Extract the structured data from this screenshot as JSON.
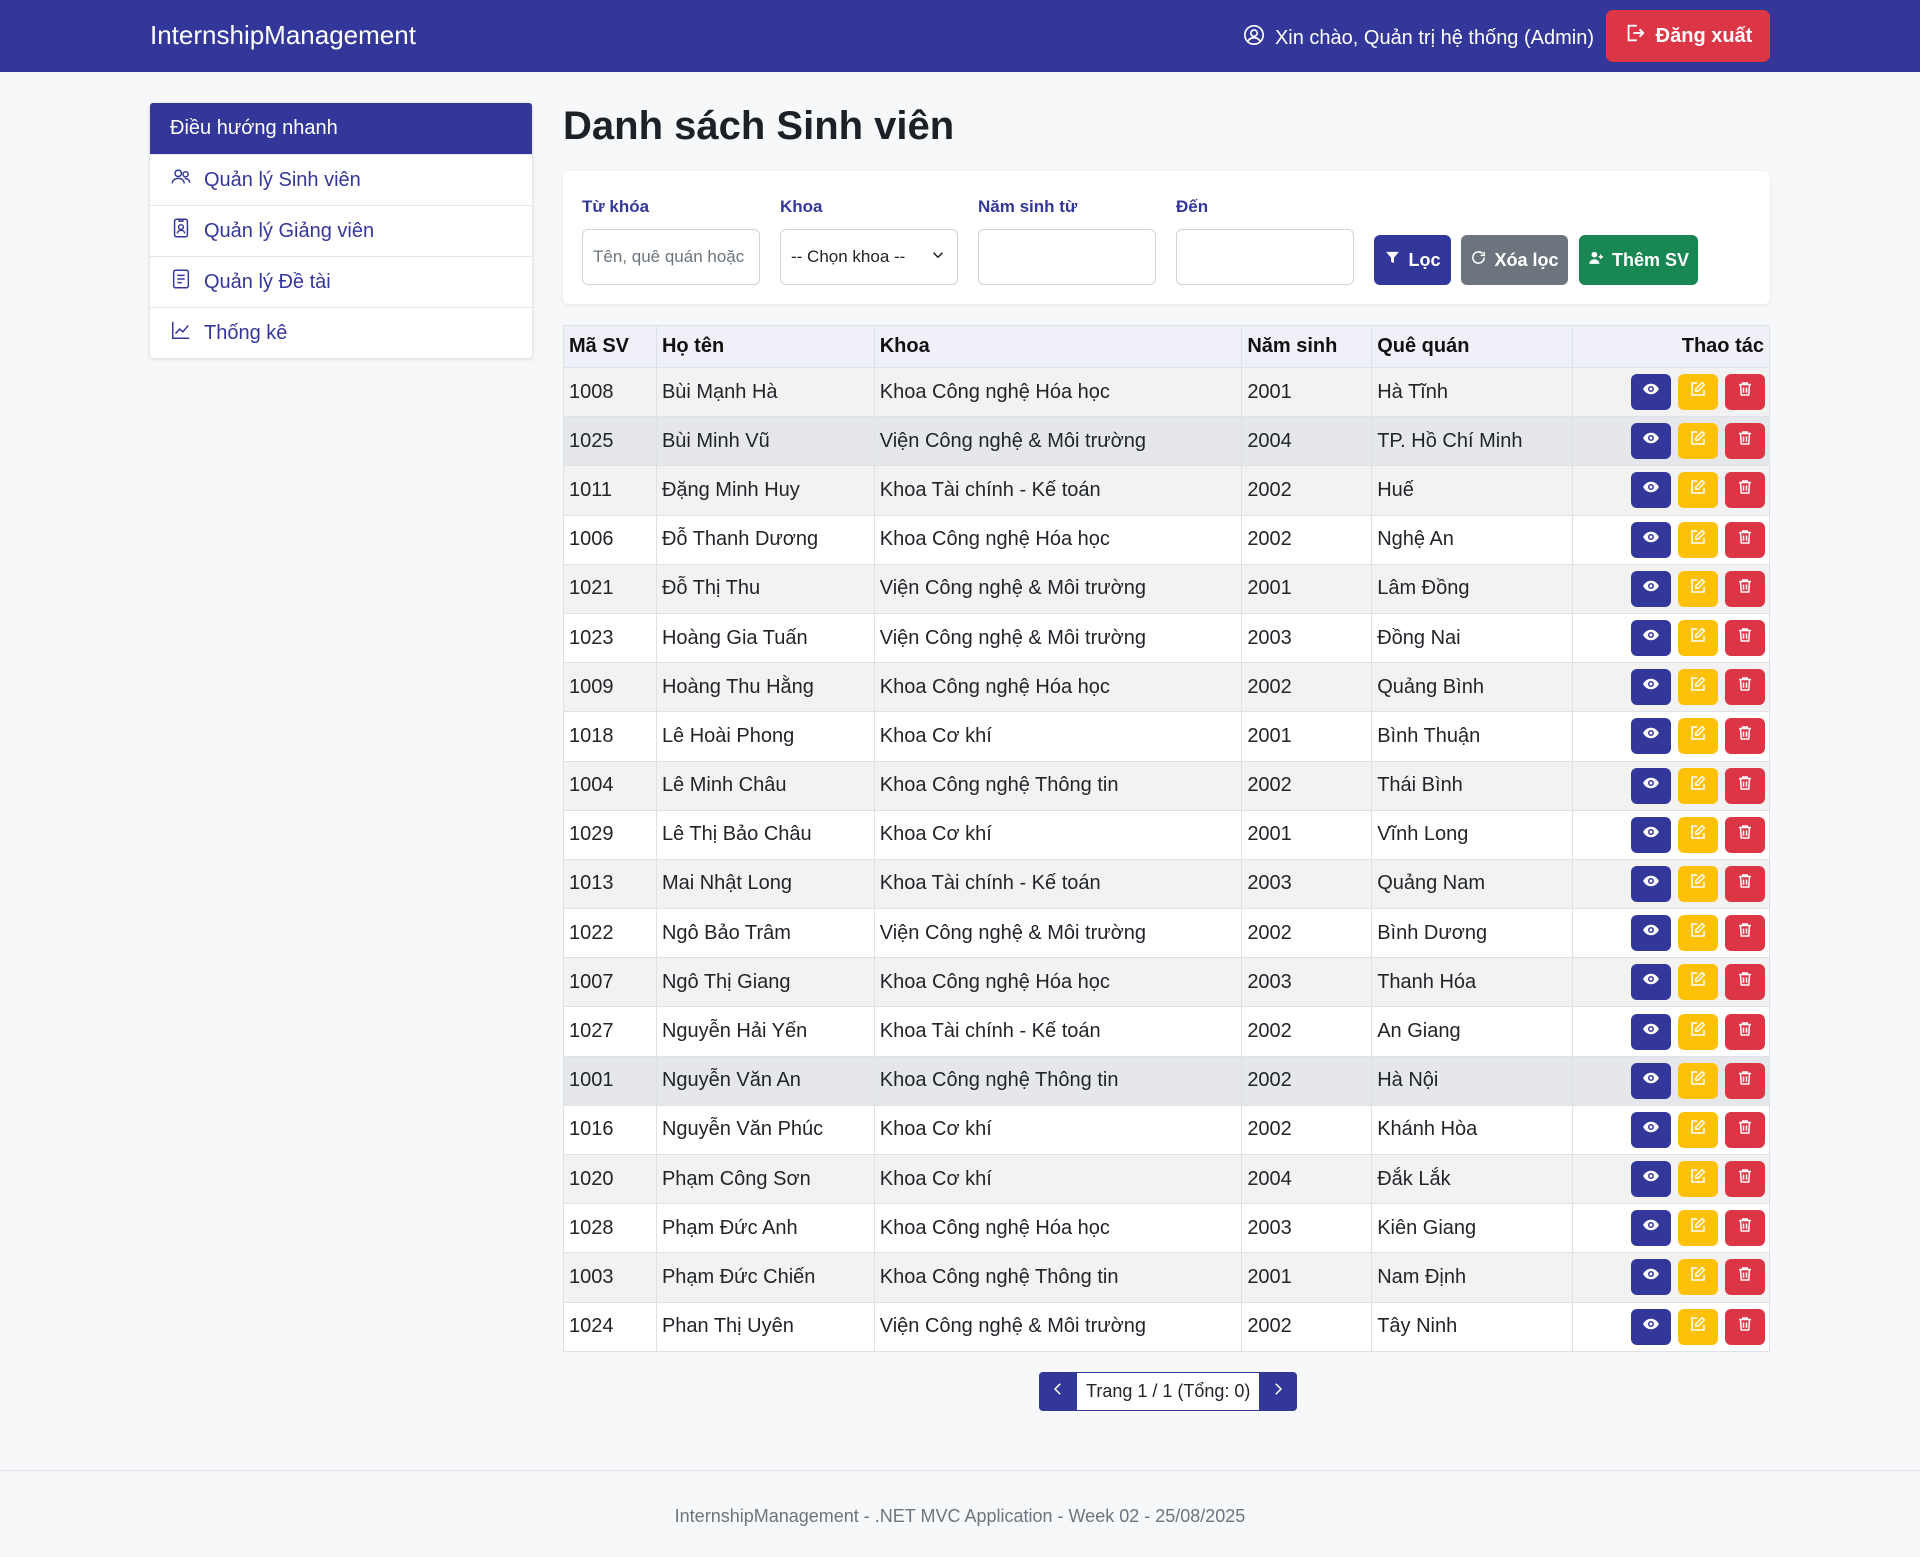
{
  "navbar": {
    "brand": "InternshipManagement",
    "greeting": "Xin chào, Quản trị hệ thống (Admin)",
    "logout_label": "Đăng xuất"
  },
  "sidebar": {
    "header": "Điều hướng nhanh",
    "items": [
      {
        "label": "Quản lý Sinh viên",
        "icon": "users-icon"
      },
      {
        "label": "Quản lý Giảng viên",
        "icon": "id-badge-icon"
      },
      {
        "label": "Quản lý Đề tài",
        "icon": "document-list-icon"
      },
      {
        "label": "Thống kê",
        "icon": "chart-line-icon"
      }
    ]
  },
  "page": {
    "title": "Danh sách Sinh viên"
  },
  "filters": {
    "keyword_label": "Từ khóa",
    "keyword_placeholder": "Tên, quê quán hoặc",
    "faculty_label": "Khoa",
    "faculty_selected": "-- Chọn khoa --",
    "year_from_label": "Năm sinh từ",
    "year_to_label": "Đến",
    "filter_button": "Lọc",
    "clear_button": "Xóa lọc",
    "add_button": "Thêm SV"
  },
  "table": {
    "headers": [
      "Mã SV",
      "Họ tên",
      "Khoa",
      "Năm sinh",
      "Quê quán",
      "Thao tác"
    ],
    "rows": [
      [
        "1008",
        "Bùi Mạnh Hà",
        "Khoa Công nghệ Hóa học",
        "2001",
        "Hà Tĩnh"
      ],
      [
        "1025",
        "Bùi Minh Vũ",
        "Viện Công nghệ & Môi trường",
        "2004",
        "TP. Hồ Chí Minh"
      ],
      [
        "1011",
        "Đặng Minh Huy",
        "Khoa Tài chính - Kế toán",
        "2002",
        "Huế"
      ],
      [
        "1006",
        "Đỗ Thanh Dương",
        "Khoa Công nghệ Hóa học",
        "2002",
        "Nghệ An"
      ],
      [
        "1021",
        "Đỗ Thị Thu",
        "Viện Công nghệ & Môi trường",
        "2001",
        "Lâm Đồng"
      ],
      [
        "1023",
        "Hoàng Gia Tuấn",
        "Viện Công nghệ & Môi trường",
        "2003",
        "Đồng Nai"
      ],
      [
        "1009",
        "Hoàng Thu Hằng",
        "Khoa Công nghệ Hóa học",
        "2002",
        "Quảng Bình"
      ],
      [
        "1018",
        "Lê Hoài Phong",
        "Khoa Cơ khí",
        "2001",
        "Bình Thuận"
      ],
      [
        "1004",
        "Lê Minh Châu",
        "Khoa Công nghệ Thông tin",
        "2002",
        "Thái Bình"
      ],
      [
        "1029",
        "Lê Thị Bảo Châu",
        "Khoa Cơ khí",
        "2001",
        "Vĩnh Long"
      ],
      [
        "1013",
        "Mai Nhật Long",
        "Khoa Tài chính - Kế toán",
        "2003",
        "Quảng Nam"
      ],
      [
        "1022",
        "Ngô Bảo Trâm",
        "Viện Công nghệ & Môi trường",
        "2002",
        "Bình Dương"
      ],
      [
        "1007",
        "Ngô Thị Giang",
        "Khoa Công nghệ Hóa học",
        "2003",
        "Thanh Hóa"
      ],
      [
        "1027",
        "Nguyễn Hải Yến",
        "Khoa Tài chính - Kế toán",
        "2002",
        "An Giang"
      ],
      [
        "1001",
        "Nguyễn Văn An",
        "Khoa Công nghệ Thông tin",
        "2002",
        "Hà Nội"
      ],
      [
        "1016",
        "Nguyễn Văn Phúc",
        "Khoa Cơ khí",
        "2002",
        "Khánh Hòa"
      ],
      [
        "1020",
        "Phạm Công Sơn",
        "Khoa Cơ khí",
        "2004",
        "Đắk Lắk"
      ],
      [
        "1028",
        "Phạm Đức Anh",
        "Khoa Công nghệ Hóa học",
        "2003",
        "Kiên Giang"
      ],
      [
        "1003",
        "Phạm Đức Chiến",
        "Khoa Công nghệ Thông tin",
        "2001",
        "Nam Định"
      ],
      [
        "1024",
        "Phan Thị Uyên",
        "Viện Công nghệ & Môi trường",
        "2002",
        "Tây Ninh"
      ]
    ],
    "row_action_icons": [
      "eye-icon",
      "edit-icon",
      "trash-icon"
    ]
  },
  "pagination": {
    "info": "Trang 1 / 1 (Tổng: 0)"
  },
  "footer": {
    "text": "InternshipManagement - .NET MVC Application - Week 02 - 25/08/2025"
  },
  "colors": {
    "primary": "#34379a",
    "danger": "#dc3545",
    "warning": "#ffc107",
    "success": "#198754",
    "secondary": "#6c757d"
  }
}
